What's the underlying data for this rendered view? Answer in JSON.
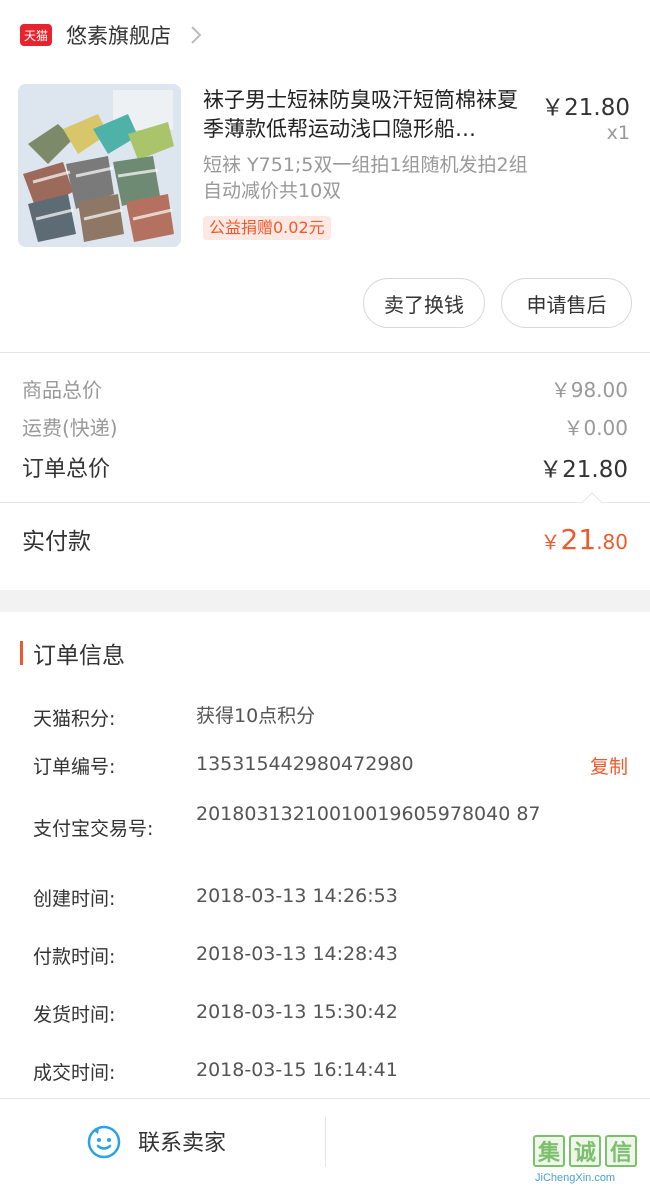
{
  "store": {
    "badge": "天猫",
    "name": "悠素旗舰店"
  },
  "product": {
    "title": "袜子男士短袜防臭吸汗短筒棉袜夏季薄款低帮运动浅口隐形船…",
    "sku": "短袜 Y751;5双一组拍1组随机发拍2组自动减价共10双",
    "charity": "公益捐赠0.02元",
    "price": "￥21.80",
    "qty": "x1"
  },
  "actions": {
    "sell_label": "卖了换钱",
    "after_sale_label": "申请售后"
  },
  "summary": {
    "goods_total_label": "商品总价",
    "goods_total_value": "￥98.00",
    "shipping_label": "运费(快递)",
    "shipping_value": "￥0.00",
    "order_total_label": "订单总价",
    "order_total_value": "￥21.80",
    "paid_label": "实付款",
    "paid_currency": "￥",
    "paid_int": "21",
    "paid_dec": ".80"
  },
  "order_info": {
    "title": "订单信息",
    "copy_label": "复制",
    "rows": [
      {
        "label": "天猫积分:",
        "value": "获得10点积分"
      },
      {
        "label": "订单编号:",
        "value": "135315442980472980"
      },
      {
        "label": "支付宝交易号:",
        "value": "20180313210010019605978040 87"
      },
      {
        "label": "创建时间:",
        "value": "2018-03-13 14:26:53"
      },
      {
        "label": "付款时间:",
        "value": "2018-03-13 14:28:43"
      },
      {
        "label": "发货时间:",
        "value": "2018-03-13 15:30:42"
      },
      {
        "label": "成交时间:",
        "value": "2018-03-15 16:14:41"
      }
    ]
  },
  "bottom": {
    "contact_label": "联系卖家"
  },
  "watermark": {
    "glyph1": "集",
    "glyph2": "诚",
    "glyph3": "信",
    "url": "JiChengXin.com"
  },
  "colors": {
    "brand_red": "#e8232e",
    "accent_orange": "#ef5a2d"
  }
}
